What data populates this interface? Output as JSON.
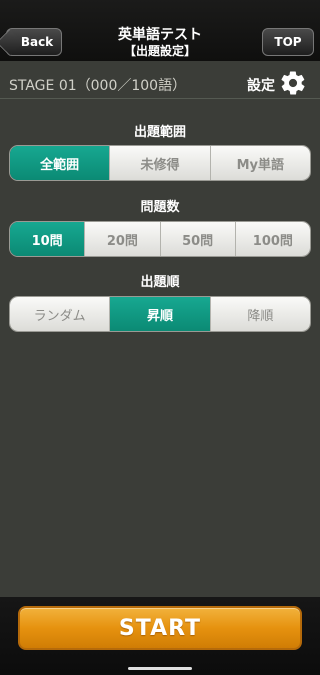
{
  "header": {
    "back_label": "Back",
    "top_label": "TOP",
    "title": "英単語テスト",
    "subtitle": "【出題設定】"
  },
  "stage": {
    "text": "STAGE 01（000／100語）",
    "settings_label": "設定",
    "settings_icon": "gear-icon"
  },
  "sections": {
    "range": {
      "title": "出題範囲",
      "options": [
        "全範囲",
        "未修得",
        "My単語"
      ],
      "selected": "全範囲"
    },
    "count": {
      "title": "問題数",
      "options": [
        "10問",
        "20問",
        "50問",
        "100問"
      ],
      "selected": "10問"
    },
    "order": {
      "title": "出題順",
      "options": [
        "ランダム",
        "昇順",
        "降順"
      ],
      "selected": "昇順"
    }
  },
  "start_label": "START",
  "colors": {
    "accent": "#0f9a82",
    "start": "#e8950f",
    "background": "#3b3d38"
  }
}
